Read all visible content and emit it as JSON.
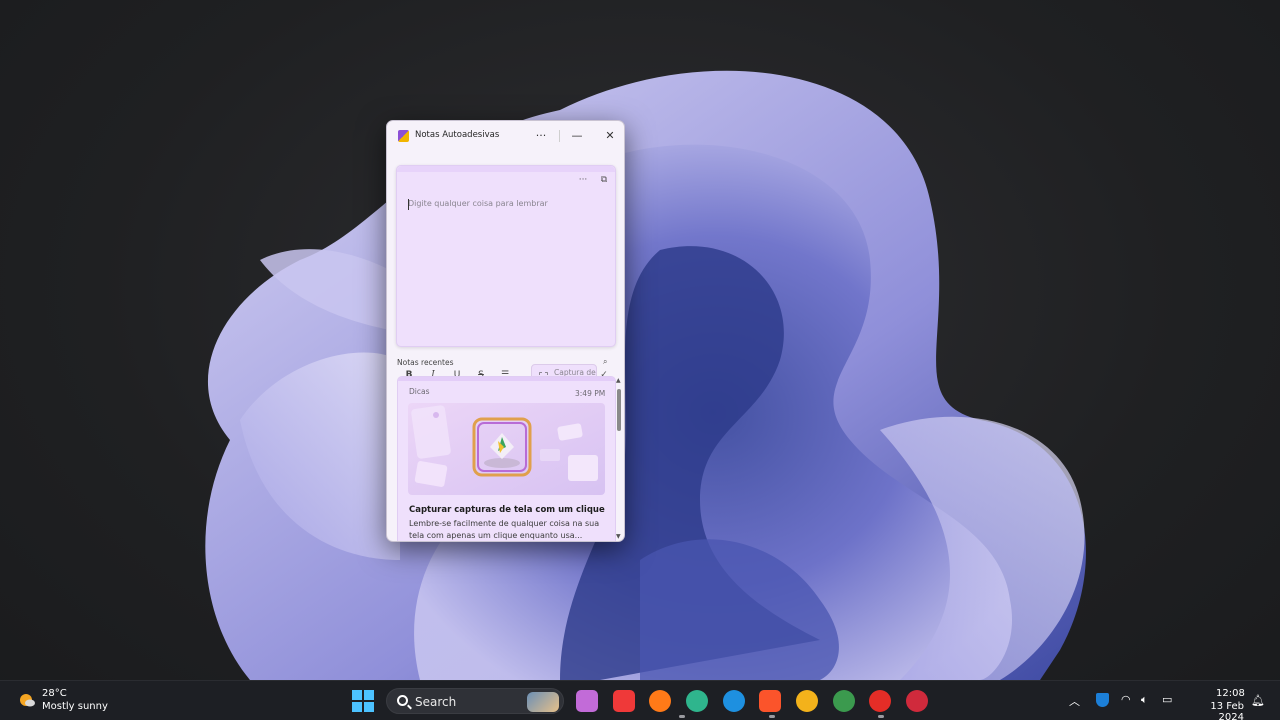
{
  "window": {
    "title": "Notas Autoadesivas",
    "more_icon": "···",
    "minimize_icon": "—",
    "close_icon": "✕"
  },
  "editor": {
    "more_icon": "···",
    "open_icon": "⧉",
    "placeholder": "Digite qualquer coisa para lembrar",
    "bold": "B",
    "italic": "I",
    "underline": "U",
    "strike": "S",
    "list": "☰",
    "capture_label": "Captura de tela",
    "check_icon": "✓"
  },
  "recent": {
    "label": "Notas recentes",
    "search_icon": "⌕"
  },
  "card": {
    "tag": "Dicas",
    "time": "3:49 PM",
    "title": "Capturar capturas de tela com um clique",
    "body": "Lembre-se facilmente de qualquer coisa na sua tela com apenas um clique enquanto usa..."
  },
  "taskbar": {
    "weather_temp": "28°C",
    "weather_desc": "Mostly sunny",
    "search_label": "Search",
    "apps": [
      {
        "name": "copilot-app-icon",
        "color": "#c26bd8"
      },
      {
        "name": "vivaldi-app-icon",
        "color": "#ef3939"
      },
      {
        "name": "firefox-app-icon",
        "color": "#ff7a18"
      },
      {
        "name": "edge-dev-app-icon",
        "color": "#2fb58d"
      },
      {
        "name": "edge-app-icon",
        "color": "#1e90e0"
      },
      {
        "name": "brave-app-icon",
        "color": "#fb542b"
      },
      {
        "name": "chrome-canary-app-icon",
        "color": "#f3b21b"
      },
      {
        "name": "chrome-app-icon",
        "color": "#3b9a4e"
      },
      {
        "name": "youtube-music-app-icon",
        "color": "#e52d27"
      },
      {
        "name": "recorder-app-icon",
        "color": "#d02a3c"
      }
    ],
    "clock_time": "12:08",
    "clock_date": "13 Feb 2024"
  }
}
